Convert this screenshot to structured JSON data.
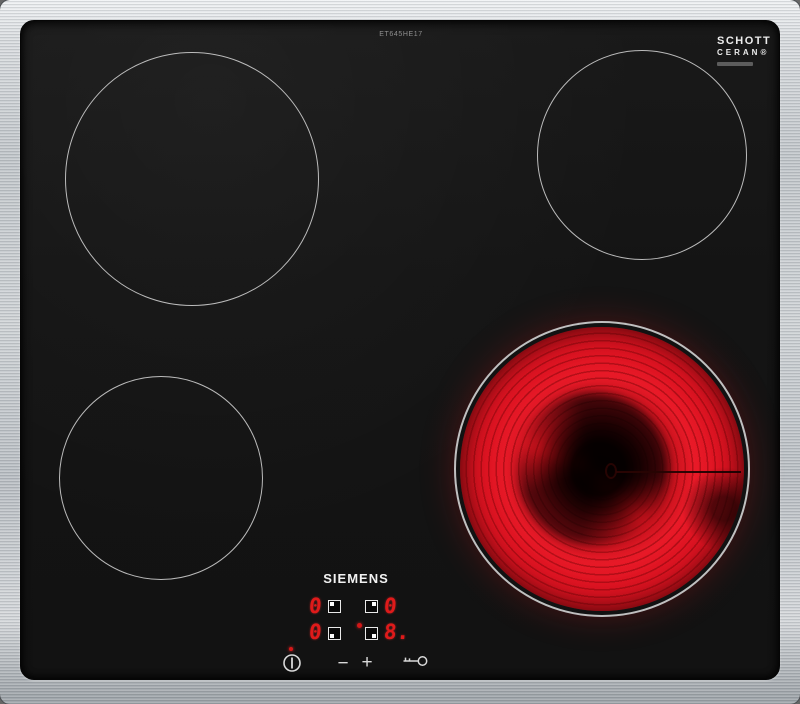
{
  "appliance": {
    "brand": "SIEMENS",
    "model_label": "ET645HE17",
    "glass_badge": {
      "line1": "SCHOTT",
      "line2": "CERAN®"
    }
  },
  "zones": [
    {
      "id": "rear-left",
      "state": "off"
    },
    {
      "id": "rear-right",
      "state": "off"
    },
    {
      "id": "front-left",
      "state": "off"
    },
    {
      "id": "front-right",
      "state": "on",
      "heat_level_displayed": "8",
      "glowing": true
    }
  ],
  "control_panel": {
    "power_led_on": true,
    "displays": [
      {
        "zone": "rear-left",
        "value": "0",
        "indicator_dot_corner": "top-left"
      },
      {
        "zone": "rear-right",
        "value": "0",
        "indicator_dot_corner": "top-right"
      },
      {
        "zone": "front-left",
        "value": "0",
        "indicator_dot_corner": "bottom-left"
      },
      {
        "zone": "front-right",
        "value": "8.",
        "indicator_dot_corner": "bottom-right",
        "selected_led": true
      }
    ],
    "buttons": {
      "power": {
        "icon": "power-icon"
      },
      "decrease": {
        "label": "−"
      },
      "increase": {
        "label": "+"
      },
      "child_lock": {
        "icon": "key-icon"
      }
    }
  },
  "colors": {
    "frame_steel": "#c6cbcf",
    "glass": "#141414",
    "zone_outline": "#d8d8d8",
    "display_red": "#df1a1a",
    "glow_red": "#ea1a28"
  }
}
